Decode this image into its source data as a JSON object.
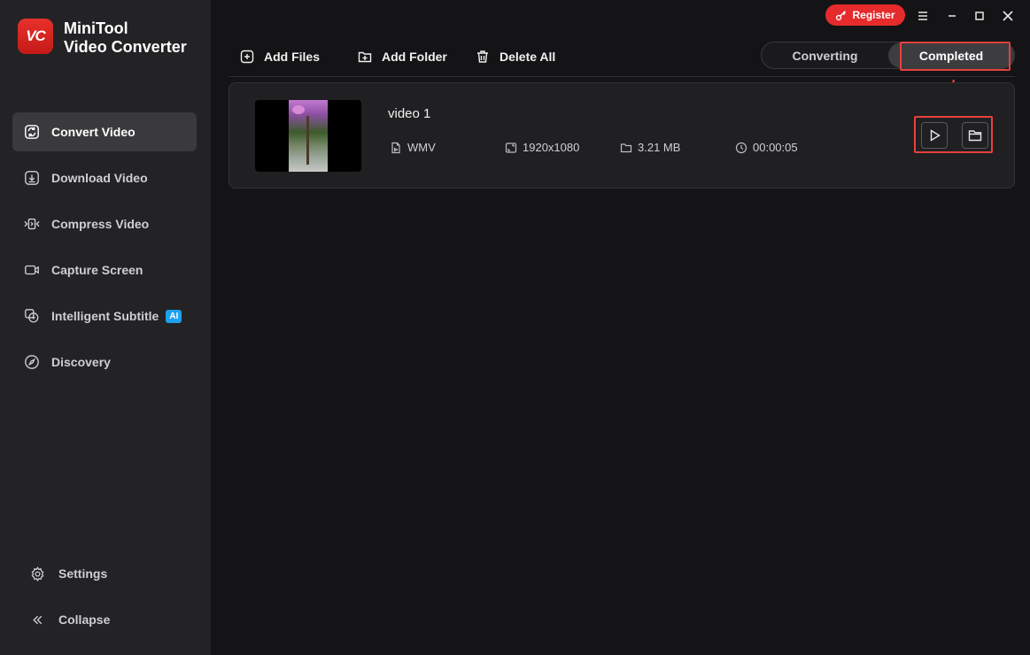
{
  "app": {
    "logo_text": "VC",
    "name_line1": "MiniTool",
    "name_line2": "Video Converter"
  },
  "sidebar": {
    "items": [
      {
        "label": "Convert Video",
        "icon": "convert-icon",
        "active": true
      },
      {
        "label": "Download Video",
        "icon": "download-icon",
        "active": false
      },
      {
        "label": "Compress Video",
        "icon": "compress-icon",
        "active": false
      },
      {
        "label": "Capture Screen",
        "icon": "camera-icon",
        "active": false
      },
      {
        "label": "Intelligent Subtitle",
        "icon": "subtitle-icon",
        "active": false,
        "badge": "AI"
      },
      {
        "label": "Discovery",
        "icon": "compass-icon",
        "active": false
      }
    ],
    "settings_label": "Settings",
    "collapse_label": "Collapse"
  },
  "titlebar": {
    "register_label": "Register"
  },
  "toolbar": {
    "add_files": "Add Files",
    "add_folder": "Add Folder",
    "delete_all": "Delete All"
  },
  "tabs": {
    "converting": "Converting",
    "completed": "Completed",
    "active": "Completed"
  },
  "file": {
    "name": "video 1",
    "format": "WMV",
    "resolution": "1920x1080",
    "size": "3.21 MB",
    "duration": "00:00:05"
  },
  "colors": {
    "accent": "#e52b2b",
    "highlight": "#e8403c",
    "ai_badge": "#1ea0f0"
  }
}
